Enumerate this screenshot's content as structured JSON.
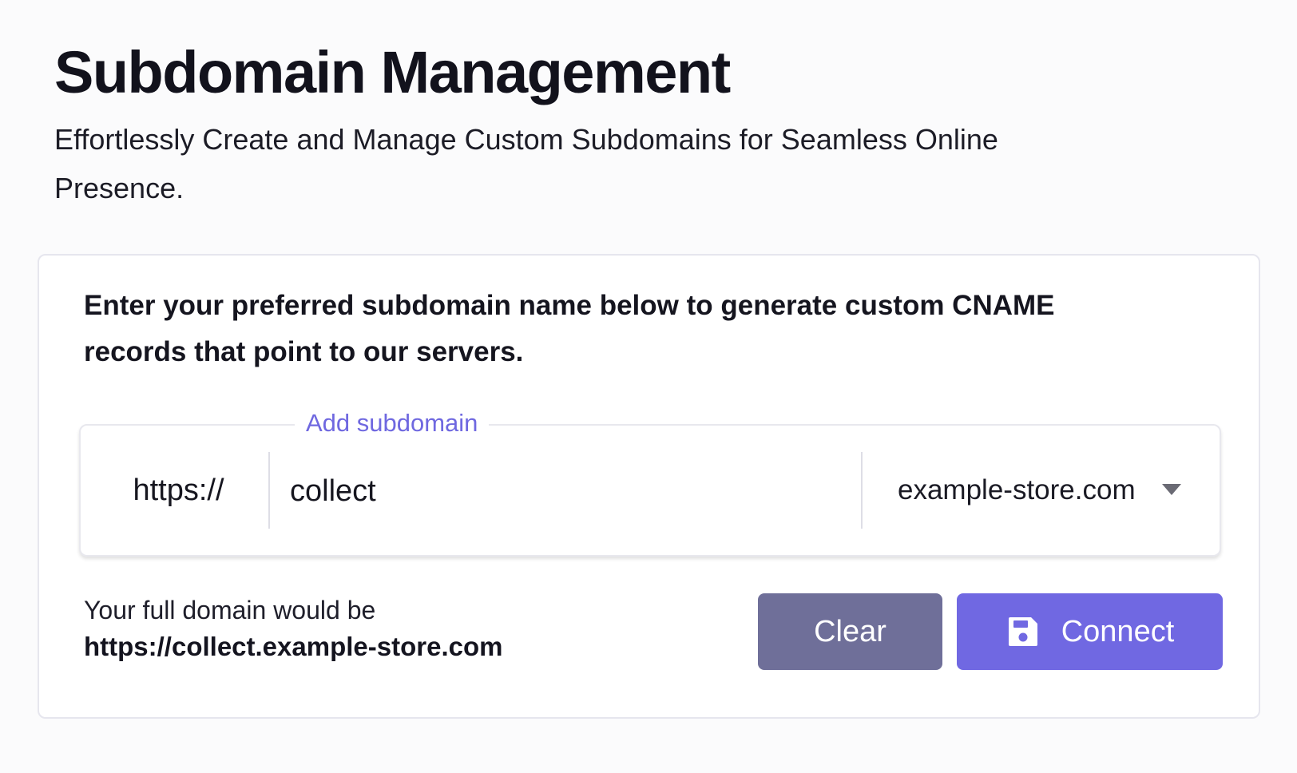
{
  "header": {
    "title": "Subdomain Management",
    "subtitle": "Effortlessly Create and Manage Custom Subdomains for Seamless Online Presence."
  },
  "card": {
    "instructions": "Enter your preferred subdomain name below to generate custom CNAME records that point to our servers.",
    "field": {
      "legend": "Add subdomain",
      "prefix": "https://",
      "value": "collect",
      "domain_selected": "example-store.com"
    },
    "full_domain": {
      "label": "Your full domain would be",
      "value": "https://collect.example-store.com"
    },
    "buttons": {
      "clear_label": "Clear",
      "connect_label": "Connect",
      "connect_icon": "save-icon"
    }
  },
  "colors": {
    "accent": "#7068e2",
    "secondary_button": "#6f6f99",
    "legend": "#6f68e0"
  }
}
